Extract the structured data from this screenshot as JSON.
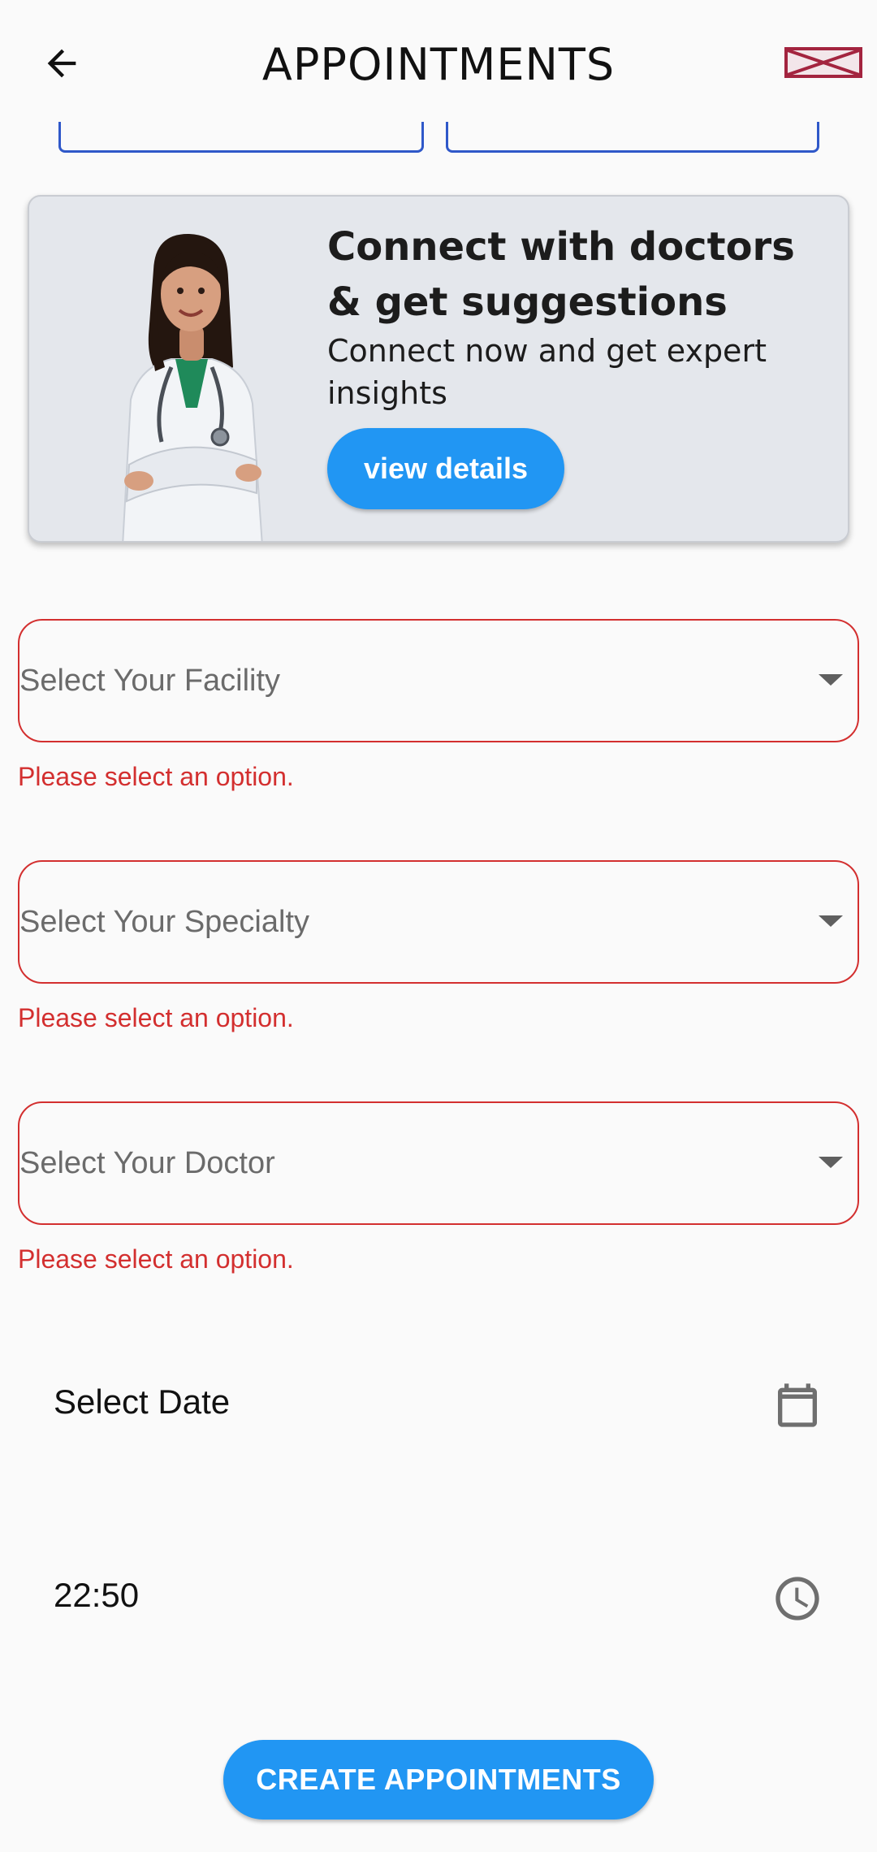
{
  "header": {
    "title": "APPOINTMENTS",
    "back_icon": "arrow-left-icon",
    "logo": "brand-logo"
  },
  "promo": {
    "title": "Connect with doctors & get suggestions",
    "subtitle": "Connect now and get expert insights",
    "button_label": "view details"
  },
  "form": {
    "facility": {
      "placeholder": "Select Your Facility",
      "error": "Please select an option."
    },
    "specialty": {
      "placeholder": "Select Your Specialty",
      "error": "Please select an option."
    },
    "doctor": {
      "placeholder": "Select Your Doctor",
      "error": "Please select an option."
    },
    "date": {
      "label": "Select Date",
      "icon": "calendar-icon"
    },
    "time": {
      "value": "22:50",
      "icon": "clock-icon"
    }
  },
  "actions": {
    "create_label": "CREATE APPOINTMENTS"
  },
  "colors": {
    "primary": "#2196f3",
    "error": "#d32f2f",
    "field_border": "#2f58c9",
    "background": "#fafafa"
  }
}
